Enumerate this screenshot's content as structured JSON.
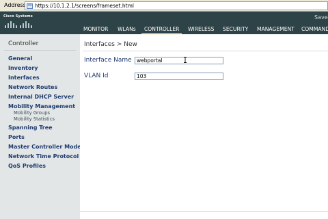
{
  "browser": {
    "address_label": "Address",
    "url": "https://10.1.2.1/screens/frameset.html"
  },
  "header": {
    "logo_text": "Cisco Systems",
    "save_label": "Save",
    "nav": [
      {
        "label": "MONITOR"
      },
      {
        "label": "WLANs"
      },
      {
        "label": "CONTROLLER"
      },
      {
        "label": "WIRELESS"
      },
      {
        "label": "SECURITY"
      },
      {
        "label": "MANAGEMENT"
      },
      {
        "label": "COMMAND"
      }
    ],
    "active_tab": "CONTROLLER",
    "colors": {
      "header_bg": "#2d4347",
      "active_underline": "#f0a30a"
    }
  },
  "sidebar": {
    "title": "Controller",
    "items": [
      {
        "label": "General"
      },
      {
        "label": "Inventory"
      },
      {
        "label": "Interfaces"
      },
      {
        "label": "Network Routes"
      },
      {
        "label": "Internal DHCP Server"
      },
      {
        "label": "Mobility Management"
      },
      {
        "label": "Mobility Groups"
      },
      {
        "label": "Mobility Statistics"
      },
      {
        "label": "Spanning Tree"
      },
      {
        "label": "Ports"
      },
      {
        "label": "Master Controller Mode"
      },
      {
        "label": "Network Time Protocol"
      },
      {
        "label": "QoS Profiles"
      }
    ]
  },
  "main": {
    "breadcrumb": "Interfaces > New",
    "fields": [
      {
        "label": "Interface Name",
        "value": "webportal"
      },
      {
        "label": "VLAN Id",
        "value": "103"
      }
    ]
  }
}
